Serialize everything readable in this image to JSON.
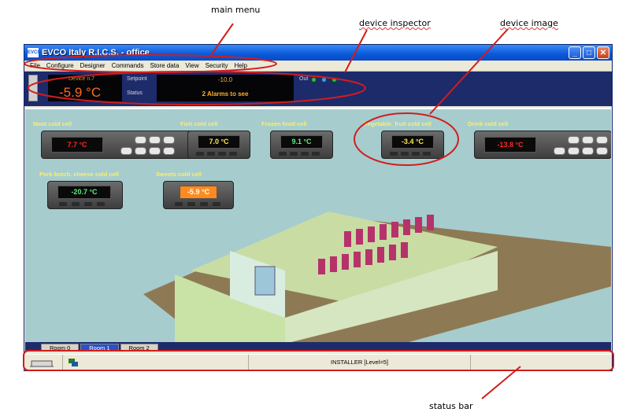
{
  "annotations": {
    "main_menu": "main menu",
    "device_inspector": "device inspector",
    "device_image": "device image",
    "status_bar": "status bar"
  },
  "window": {
    "title": "EVCO Italy  R.I.C.S.  -  office",
    "logo_text": "EVCO",
    "buttons": {
      "minimize": "_",
      "maximize": "□",
      "close": "✕"
    }
  },
  "menu": [
    "File",
    "Configure",
    "Designer",
    "Commands",
    "Store data",
    "View",
    "Security",
    "Help"
  ],
  "inspector": {
    "device_label": "Device n.7",
    "temperature": "-5.9 °C",
    "setpoint_label": "Setpoint",
    "status_label": "Status",
    "setpoint_value": "-10.0",
    "status_value": "2 Alarms to see",
    "out_label": "Out"
  },
  "cells": [
    {
      "name": "Meat cold cell",
      "temp": "7.7 °C",
      "color": "#ff2a2a"
    },
    {
      "name": "Fish cold cell",
      "temp": "7.0 °C",
      "color": "#ffe84a"
    },
    {
      "name": "Frozen food cell",
      "temp": "9.1 °C",
      "color": "#5ef07a"
    },
    {
      "name": "Vegetable_fruit cold cell",
      "temp": "-3.4 °C",
      "color": "#ffe84a"
    },
    {
      "name": "Drink cold cell",
      "temp": "-13.8 °C",
      "color": "#ff2a2a"
    },
    {
      "name": "Pork butch. cheese cold cell",
      "temp": "-20.7 °C",
      "color": "#5ef07a"
    },
    {
      "name": "Sweets cold cell",
      "temp": "-5.9 °C",
      "color": "#ffffff"
    }
  ],
  "tabs": [
    "Room 0",
    "Room 1",
    "Room 2"
  ],
  "active_tab": "Room 1",
  "status": {
    "user_level": "INSTALLER [Level=5]"
  },
  "colors": {
    "title_bar": "#0a58d8",
    "inspector_bg": "#1d2b6b",
    "canvas_bg": "#a6ccce",
    "callout_red": "#d31c1c",
    "cell_label": "#ffef63"
  }
}
